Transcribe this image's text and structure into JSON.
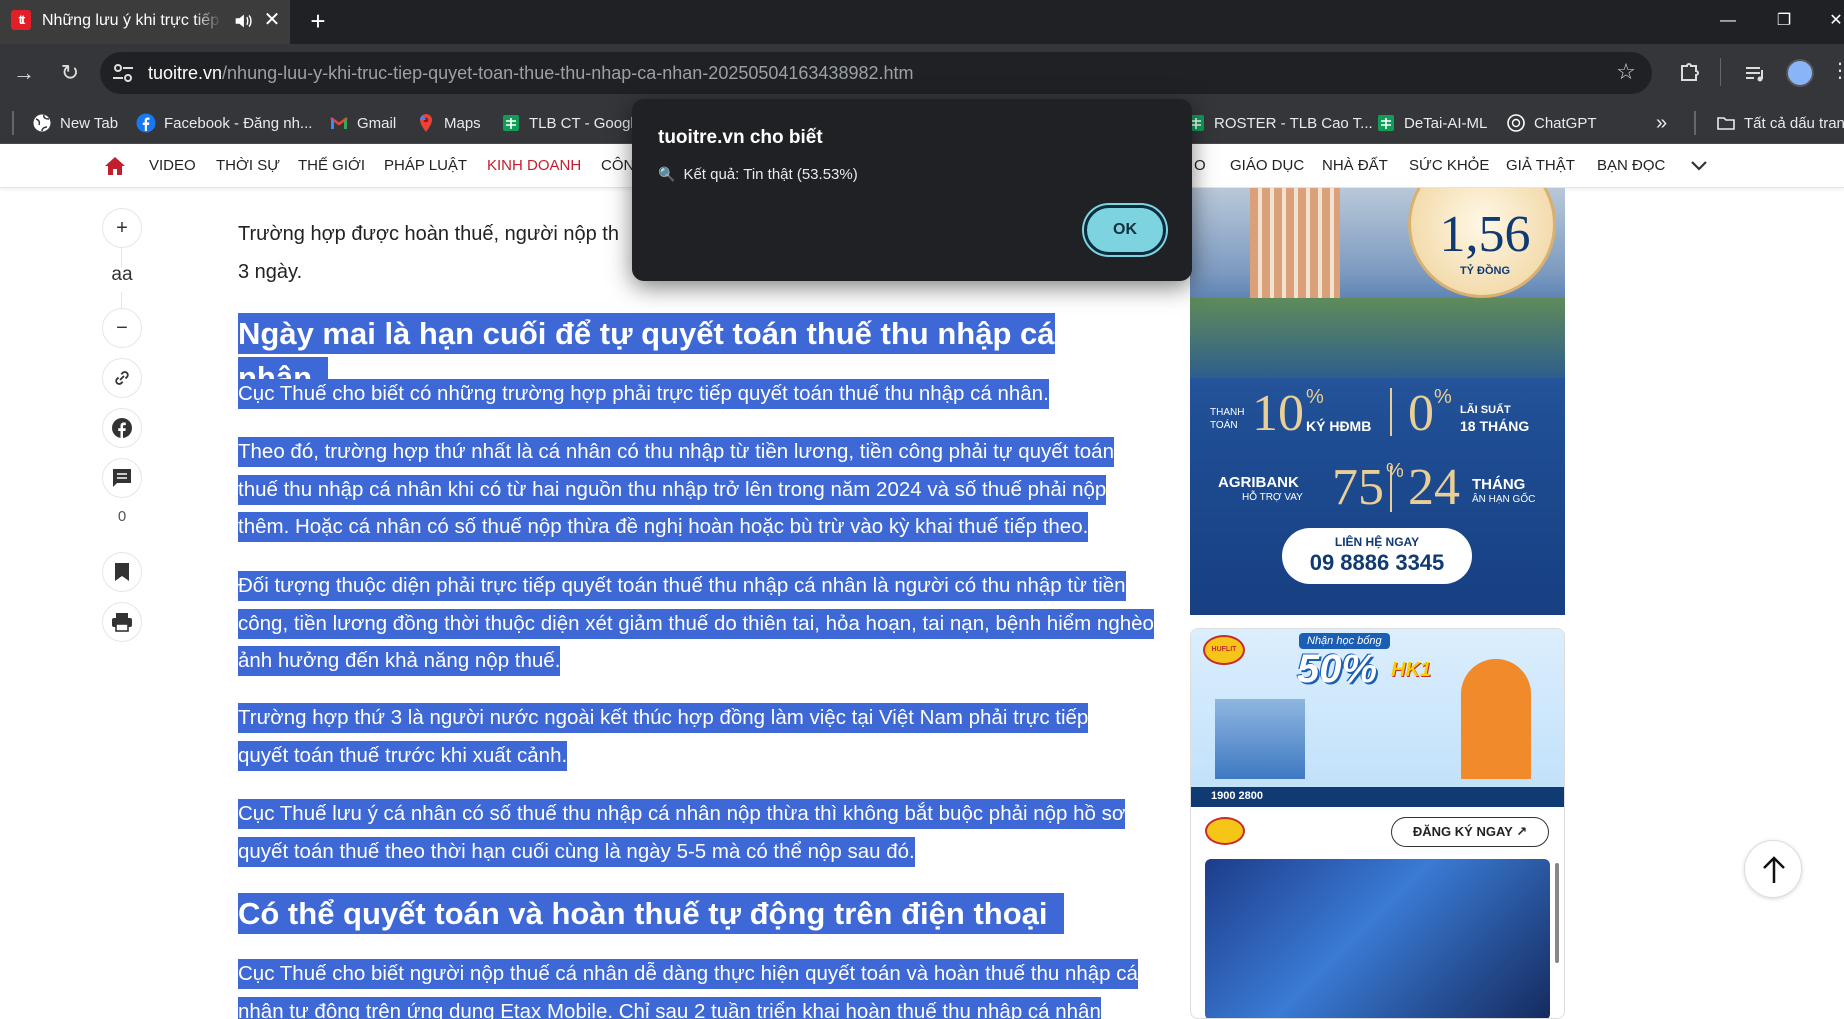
{
  "browser": {
    "tab_title": "Những lưu ý khi trực tiếp quyết toán thuế",
    "url_host": "tuoitre.vn",
    "url_path": "/nhung-luu-y-khi-truc-tiep-quyet-toan-thue-thu-nhap-ca-nhan-20250504163438982.htm",
    "bookmarks": [
      {
        "label": "New Tab",
        "icon": "globe-icon"
      },
      {
        "label": "Facebook - Đăng nh...",
        "icon": "facebook-icon"
      },
      {
        "label": "Gmail",
        "icon": "gmail-icon"
      },
      {
        "label": "Maps",
        "icon": "maps-icon"
      },
      {
        "label": "TLB CT - Google",
        "icon": "sheets-icon"
      },
      {
        "label": "ROSTER - TLB Cao T...",
        "icon": "sheets-icon"
      },
      {
        "label": "DeTai-AI-ML",
        "icon": "sheets-icon"
      },
      {
        "label": "ChatGPT",
        "icon": "chatgpt-icon"
      }
    ],
    "all_bookmarks": "Tất cả dấu tran"
  },
  "site_nav": {
    "items": [
      "VIDEO",
      "THỜI SỰ",
      "THẾ GIỚI",
      "PHÁP LUẬT",
      "KINH DOANH",
      "CÔN",
      "O",
      "GIÁO DỤC",
      "NHÀ ĐẤT",
      "SỨC KHỎE",
      "GIẢ THẬT",
      "BẠN ĐỌC"
    ],
    "active": "KINH DOANH"
  },
  "rail": {
    "font_label": "aa",
    "comment_count": "0"
  },
  "article": {
    "intro_line1": "Trường hợp được hoàn thuế, người nộp th",
    "intro_line2": "3 ngày.",
    "heading1": "Ngày mai là hạn cuối để tự quyết toán thuế thu nhập cá nhân",
    "p1": "Cục Thuế cho biết có những trường hợp phải trực tiếp quyết toán thuế thu nhập cá nhân.",
    "p2": "Theo đó, trường hợp thứ nhất là cá nhân có thu nhập từ tiền lương, tiền công phải tự quyết toán thuế thu nhập cá nhân khi có từ hai nguồn thu nhập trở lên trong năm 2024 và số thuế phải nộp thêm. Hoặc cá nhân có số thuế nộp thừa đề nghị hoàn hoặc bù trừ vào kỳ khai thuế tiếp theo.",
    "p3": "Đối tượng thuộc diện phải trực tiếp quyết toán thuế thu nhập cá nhân là người có thu nhập từ tiền công, tiền lương đồng thời thuộc diện xét giảm thuế do thiên tai, hỏa hoạn, tai nạn, bệnh hiểm nghèo ảnh hưởng đến khả năng nộp thuế.",
    "p4": "Trường hợp thứ 3 là người nước ngoài kết thúc hợp đồng làm việc tại Việt Nam phải trực tiếp quyết toán thuế trước khi xuất cảnh.",
    "p5": "Cục Thuế lưu ý cá nhân có số thuế thu nhập cá nhân nộp thừa thì không bắt buộc phải nộp hồ sơ quyết toán thuế theo thời hạn cuối cùng là ngày 5-5 mà có thể nộp sau đó.",
    "heading2": "Có thể quyết toán và hoàn thuế tự động trên điện thoại",
    "p6": "Cục Thuế cho biết người nộp thuế cá nhân dễ dàng thực hiện quyết toán và hoàn thuế thu nhập cá nhân tự động trên ứng dụng Etax Mobile. Chỉ sau 2 tuần triển khai hoàn thuế thu nhập cá nhân"
  },
  "ad1": {
    "price": "1,56",
    "price_unit": "TỶ ĐỒNG",
    "pay_label": "THANH TOÁN",
    "pct1": "10",
    "pct1_label": "KÝ HĐMB",
    "pct2": "0",
    "pct2_label_a": "LÃI SUẤT",
    "pct2_label_b": "18 THÁNG",
    "bank": "AGRIBANK",
    "bank_sub": "HỖ TRỢ VAY",
    "pct3": "75",
    "months": "24",
    "months_label_a": "THÁNG",
    "months_label_b": "ÂN HẠN GỐC",
    "cta": "LIÊN HỆ NGAY",
    "phone": "09 8886 3345"
  },
  "ad2": {
    "banner_top": "Nhận học bổng",
    "banner_pct": "50%",
    "banner_hk": "HK1",
    "banner_phone": "1900 2800",
    "brand": "HUFLIT",
    "register": "ĐĂNG KÝ NGAY"
  },
  "dialog": {
    "title": "tuoitre.vn cho biết",
    "message": "Kết quả: Tin thật (53.53%)",
    "ok": "OK"
  }
}
